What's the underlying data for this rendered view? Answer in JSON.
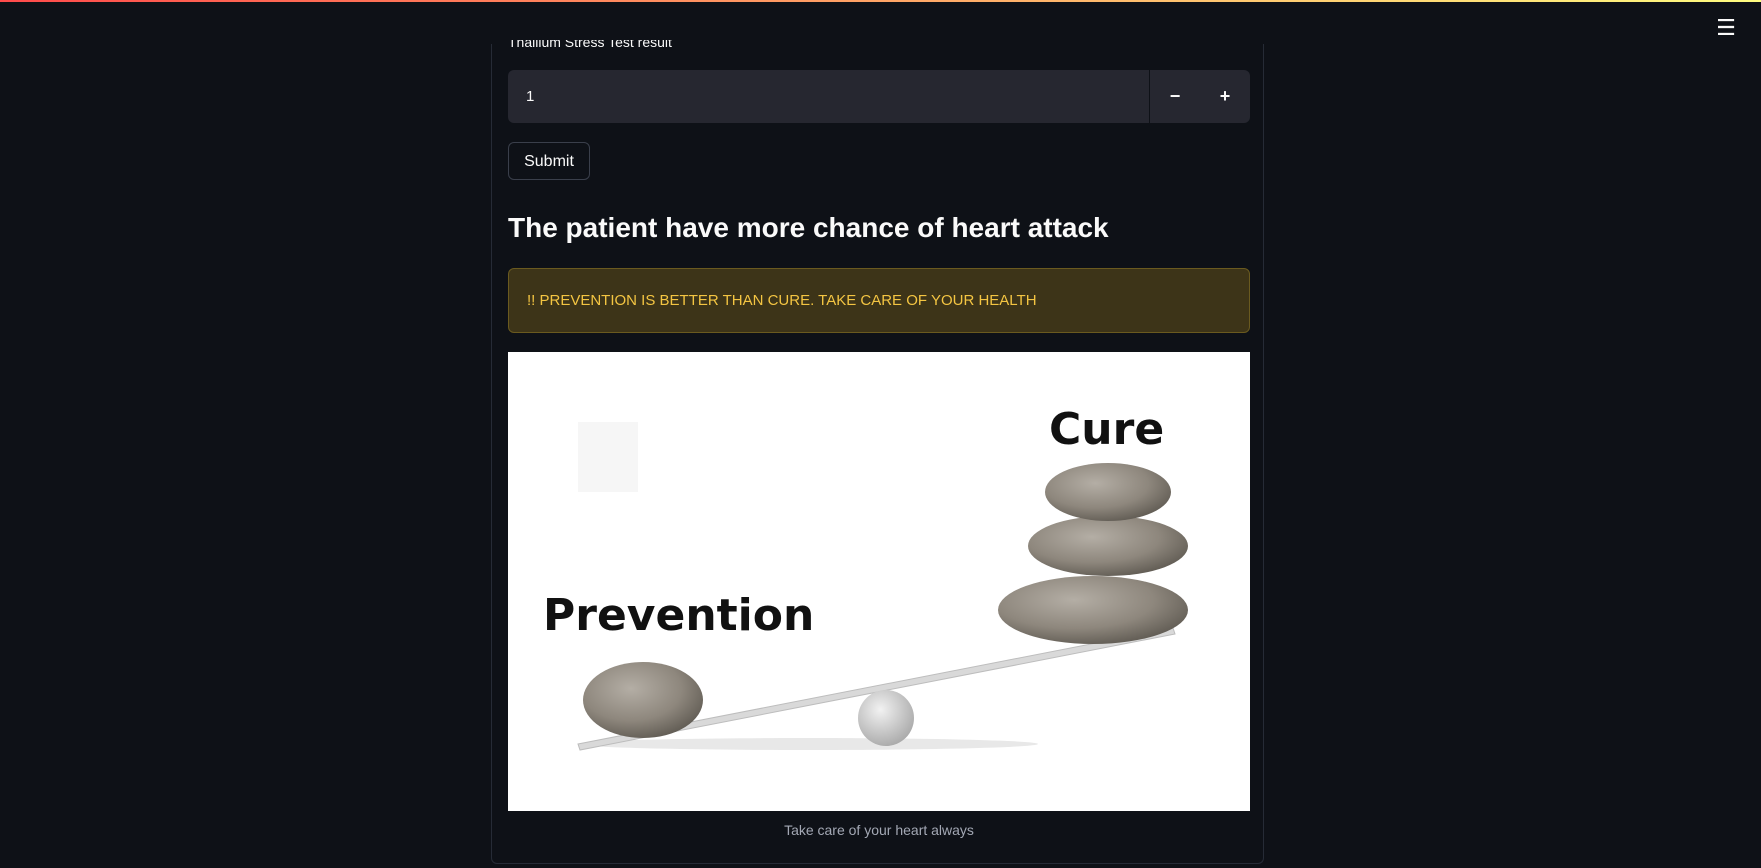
{
  "header": {
    "menu_icon": "hamburger-icon"
  },
  "form": {
    "field_label": "Thallium Stress Test result",
    "field_value": "1",
    "decrement_label": "−",
    "increment_label": "+",
    "submit_label": "Submit"
  },
  "result": {
    "heading": "The patient have more chance of heart attack",
    "warning": "!! PREVENTION IS BETTER THAN CURE. TAKE CARE OF YOUR HEALTH"
  },
  "image": {
    "cure_label": "Cure",
    "prevention_label": "Prevention",
    "caption": "Take care of your heart always"
  },
  "colors": {
    "background": "#0e1117",
    "warning_bg": "#3d3418",
    "warning_text": "#f4c542",
    "input_bg": "#262730"
  }
}
